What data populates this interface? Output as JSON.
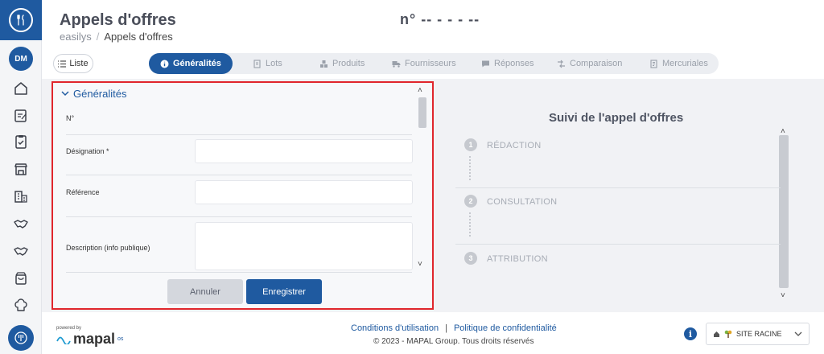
{
  "sidebar": {
    "avatar_initials": "DM"
  },
  "header": {
    "title": "Appels d'offres",
    "number": "n° -- - - - --",
    "breadcrumb": {
      "root": "easilys",
      "separator": "/",
      "current": "Appels d'offres"
    }
  },
  "toolbar": {
    "list_label": "Liste"
  },
  "tabs": [
    {
      "label": "Généralités",
      "active": true
    },
    {
      "label": "Lots"
    },
    {
      "label": "Produits"
    },
    {
      "label": "Fournisseurs"
    },
    {
      "label": "Réponses"
    },
    {
      "label": "Comparaison"
    },
    {
      "label": "Mercuriales"
    }
  ],
  "form": {
    "section_title": "Généralités",
    "fields": {
      "number_label": "N°",
      "designation_label": "Désignation *",
      "designation_value": "",
      "reference_label": "Référence",
      "reference_value": "",
      "description_label": "Description (info publique)",
      "description_value": ""
    },
    "cancel_label": "Annuler",
    "save_label": "Enregistrer"
  },
  "tracking": {
    "title": "Suivi de l'appel d'offres",
    "steps": [
      {
        "number": "1",
        "label": "RÉDACTION"
      },
      {
        "number": "2",
        "label": "CONSULTATION"
      },
      {
        "number": "3",
        "label": "ATTRIBUTION"
      }
    ]
  },
  "footer": {
    "powered_by": "powered by",
    "brand": "mapal",
    "brand_suffix": "os",
    "terms_link": "Conditions d'utilisation",
    "links_separator": "|",
    "privacy_link": "Politique de confidentialité",
    "copyright": "© 2023 - MAPAL Group. Tous droits réservés",
    "site_label": "SITE RACINE"
  },
  "colors": {
    "brand_blue": "#1f5aa0",
    "highlight_red": "#e0262c"
  }
}
